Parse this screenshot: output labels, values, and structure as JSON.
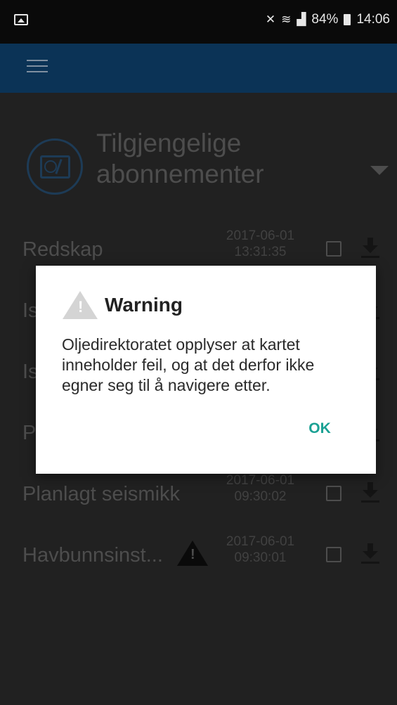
{
  "status_bar": {
    "battery": "84%",
    "time": "14:06"
  },
  "header": {
    "title": "Tilgjengelige abonnementer"
  },
  "rows": [
    {
      "name": "Redskap",
      "date": "2017-06-01",
      "time": "13:31:35",
      "checked": false
    },
    {
      "name": "Is",
      "date": "",
      "time": "",
      "checked": false
    },
    {
      "name": "Is",
      "date": "",
      "time": "",
      "checked": false
    },
    {
      "name": "P",
      "date": "",
      "time": "",
      "checked": false
    },
    {
      "name": "Planlagt seismikk",
      "date": "2017-06-01",
      "time": "09:30:02",
      "checked": false
    },
    {
      "name": "Havbunnsinst...",
      "date": "2017-06-01",
      "time": "09:30:01",
      "checked": false,
      "warning": true
    }
  ],
  "dialog": {
    "title": "Warning",
    "message": "Oljedirektoratet opplyser at kartet inneholder feil, og at det derfor ikke egner seg til å navigere etter.",
    "ok_label": "OK"
  },
  "colors": {
    "app_bar": "#0b3356",
    "ok_accent": "#1ba194"
  }
}
